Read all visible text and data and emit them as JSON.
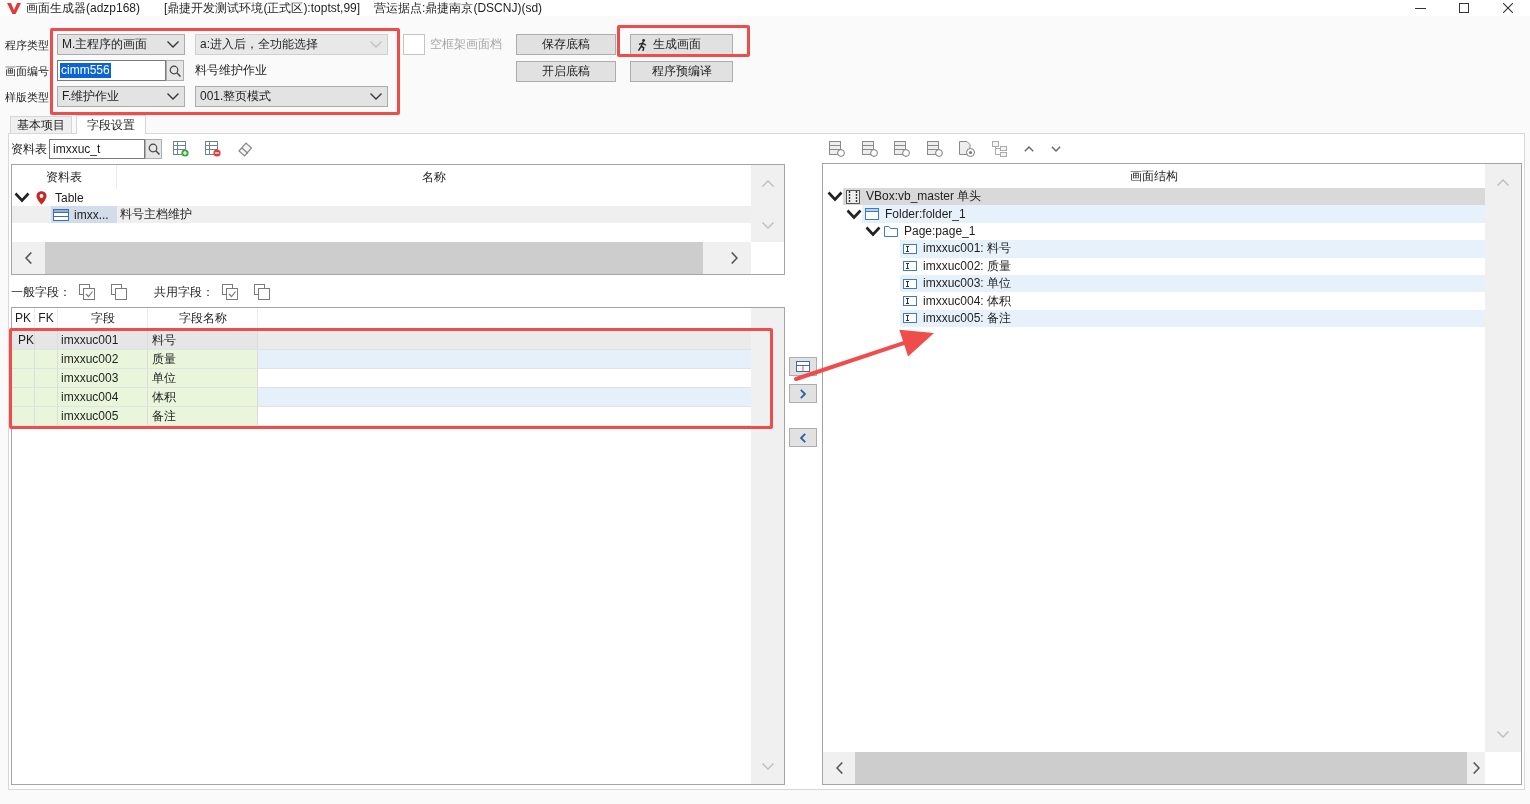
{
  "window": {
    "title": "画面生成器(adzp168)",
    "environment": "[鼎捷开发测试环境(正式区):toptst,99]",
    "site": "营运据点:鼎捷南京(DSCNJ)(sd)"
  },
  "form": {
    "highlighted": true,
    "program_type": {
      "label": "程序类型",
      "value": "M.主程序的画面"
    },
    "program_mode": {
      "value": "a:进入后，全功能选择",
      "disabled": true
    },
    "frame_file": {
      "label": "空框架画面档",
      "disabled": true
    },
    "screen_id": {
      "label": "画面编号",
      "value": "cimm556",
      "text_selected": true
    },
    "screen_name": "料号维护作业",
    "template_type": {
      "label": "样版类型",
      "value": "F.维护作业"
    },
    "layout_mode": {
      "value": "001.整页模式"
    }
  },
  "buttons": [
    {
      "label": "保存底稿",
      "kind": "text",
      "highlighted": false
    },
    {
      "label": "生成画面",
      "kind": "run",
      "highlighted": true
    },
    {
      "label": "开启底稿",
      "kind": "text",
      "highlighted": false
    },
    {
      "label": "程序预编译",
      "kind": "text",
      "highlighted": false
    }
  ],
  "tabs": [
    {
      "label": "基本项目",
      "selected": false
    },
    {
      "label": "字段设置",
      "selected": true
    }
  ],
  "table_picker": {
    "label": "资料表",
    "value": "imxxuc_t"
  },
  "table_tree": {
    "columns": [
      "资料表",
      "名称"
    ],
    "items": [
      {
        "label": "Table",
        "expanded": true,
        "selected": false,
        "children": [
          {
            "label": "imxx...",
            "name": "料号主档维护",
            "selected": true
          }
        ]
      }
    ]
  },
  "field_groups": [
    {
      "label": "一般字段："
    },
    {
      "label": "共用字段："
    }
  ],
  "fields_grid": {
    "highlighted": true,
    "columns": [
      "PK",
      "FK",
      "字段",
      "字段名称"
    ],
    "rows": [
      {
        "pk": "PK",
        "field": "imxxuc001",
        "name": "料号",
        "selected": true
      },
      {
        "field": "imxxuc002",
        "name": "质量",
        "selected": false
      },
      {
        "field": "imxxuc003",
        "name": "单位",
        "selected": false
      },
      {
        "field": "imxxuc004",
        "name": "体积",
        "selected": false
      },
      {
        "field": "imxxuc005",
        "name": "备注",
        "selected": false
      }
    ]
  },
  "annotation_arrow": true,
  "structure_tree": {
    "title": "画面结构",
    "items": [
      {
        "label": "VBox:vb_master 单头",
        "kind": "vbox",
        "expanded": true,
        "selected": true,
        "children": [
          {
            "label": "Folder:folder_1",
            "kind": "folder",
            "expanded": true,
            "selected": false,
            "children": [
              {
                "label": "Page:page_1",
                "kind": "page",
                "expanded": true,
                "selected": false,
                "children": [
                  {
                    "label": "imxxuc001: 料号",
                    "kind": "field",
                    "selected": false
                  },
                  {
                    "label": "imxxuc002: 质量",
                    "kind": "field",
                    "selected": false
                  },
                  {
                    "label": "imxxuc003: 单位",
                    "kind": "field",
                    "selected": false
                  },
                  {
                    "label": "imxxuc004: 体积",
                    "kind": "field",
                    "selected": false
                  },
                  {
                    "label": "imxxuc005: 备注",
                    "kind": "field",
                    "selected": false
                  }
                ]
              }
            ]
          }
        ]
      }
    ]
  }
}
